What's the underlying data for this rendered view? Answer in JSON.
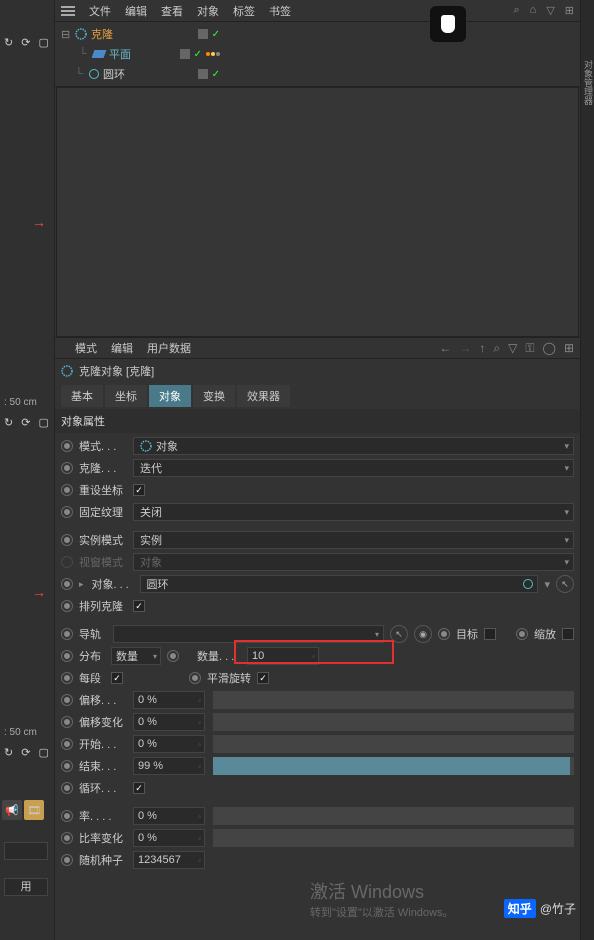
{
  "top_menu": {
    "file": "文件",
    "edit": "编辑",
    "view": "查看",
    "object": "对象",
    "tags": "标签",
    "bookmarks": "书签"
  },
  "hierarchy": {
    "clone": "克隆",
    "plane": "平面",
    "circle": "圆环"
  },
  "attr_menu": {
    "mode": "模式",
    "edit": "编辑",
    "userdata": "用户数据"
  },
  "attr_header": "克隆对象 [克隆]",
  "tabs": {
    "basic": "基本",
    "coord": "坐标",
    "object": "对象",
    "transform": "变换",
    "effectors": "效果器"
  },
  "section_title": "对象属性",
  "props": {
    "mode": {
      "label": "模式. . .",
      "value": "对象"
    },
    "clone": {
      "label": "克隆. . .",
      "value": "迭代"
    },
    "reset_coord": {
      "label": "重设坐标"
    },
    "fix_texture": {
      "label": "固定纹理",
      "value": "关闭"
    },
    "instance_mode": {
      "label": "实例模式",
      "value": "实例"
    },
    "viewport_mode": {
      "label": "视窗模式",
      "value": "对象"
    },
    "object": {
      "label": "对象. . .",
      "value": "圆环"
    },
    "arrange_clone": {
      "label": "排列克隆"
    },
    "rail": {
      "label": "导轨"
    },
    "target": {
      "label": "目标"
    },
    "scale": {
      "label": "缩放"
    },
    "distribution": {
      "label": "分布",
      "value": "数量"
    },
    "count": {
      "label": "数量. . .",
      "value": "10"
    },
    "per_segment": {
      "label": "每段"
    },
    "smooth_rotation": {
      "label": "平滑旋转"
    },
    "offset": {
      "label": "偏移. . .",
      "value": "0 %"
    },
    "offset_var": {
      "label": "偏移变化",
      "value": "0 %"
    },
    "start": {
      "label": "开始. . .",
      "value": "0 %"
    },
    "end": {
      "label": "结束. . .",
      "value": "99 %"
    },
    "loop": {
      "label": "循环. . ."
    },
    "rate": {
      "label": "率. . . .",
      "value": "0 %"
    },
    "rate_var": {
      "label": "比率变化",
      "value": "0 %"
    },
    "random_seed": {
      "label": "随机种子",
      "value": "1234567"
    }
  },
  "left_edge": {
    "label1": ": 50 cm",
    "label2": ": 50 cm",
    "bottom_btn": "用"
  },
  "watermark": {
    "title": "激活 Windows",
    "sub": "转到\"设置\"以激活 Windows。"
  },
  "zhihu": {
    "logo": "知乎",
    "author": "@竹子"
  }
}
